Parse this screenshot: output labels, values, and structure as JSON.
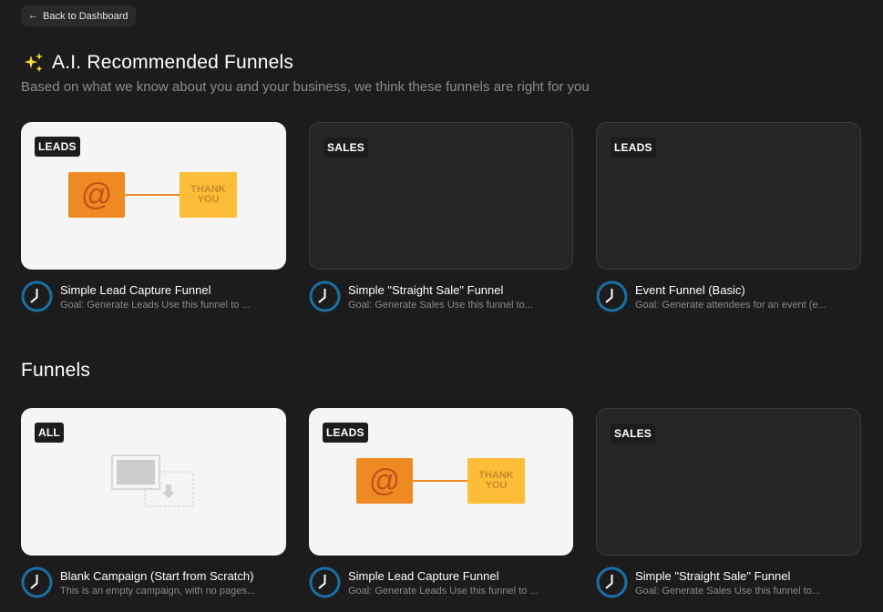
{
  "back_button": {
    "label": "Back to Dashboard"
  },
  "recommended": {
    "title": "A.I. Recommended Funnels",
    "subtitle": "Based on what we know about you and your business, we think these funnels are right for you",
    "cards": [
      {
        "badge": "LEADS",
        "thumb": "lead-capture",
        "title": "Simple Lead Capture Funnel",
        "desc": "Goal: Generate Leads Use this funnel to ..."
      },
      {
        "badge": "SALES",
        "thumb": "empty",
        "title": "Simple \"Straight Sale\" Funnel",
        "desc": "Goal: Generate Sales Use this funnel to..."
      },
      {
        "badge": "LEADS",
        "thumb": "empty",
        "title": "Event Funnel (Basic)",
        "desc": "Goal: Generate attendees for an event (e..."
      }
    ]
  },
  "funnels": {
    "title": "Funnels",
    "cards": [
      {
        "badge": "ALL",
        "thumb": "blank",
        "title": "Blank Campaign (Start from Scratch)",
        "desc": "This is an empty campaign, with no pages..."
      },
      {
        "badge": "LEADS",
        "thumb": "lead-capture",
        "title": "Simple Lead Capture Funnel",
        "desc": "Goal: Generate Leads Use this funnel to ..."
      },
      {
        "badge": "SALES",
        "thumb": "empty",
        "title": "Simple \"Straight Sale\" Funnel",
        "desc": "Goal: Generate Sales Use this funnel to..."
      }
    ]
  },
  "illustration": {
    "at_symbol": "@",
    "thank": "THANK",
    "you": "YOU"
  },
  "colors": {
    "background": "#1c1c1c",
    "accent_blue": "#1a6fa8",
    "orange": "#ef8a22",
    "yellow": "#fdbd36"
  },
  "icons": {
    "back": "arrow-left-icon",
    "sparkle": "sparkles-icon",
    "card": "clock-icon"
  }
}
